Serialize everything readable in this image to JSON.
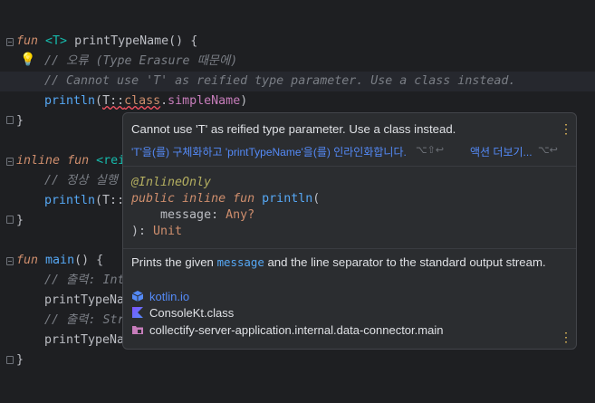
{
  "editor": {
    "lines": {
      "l1": {
        "kw": "fun",
        "tp": "<T>",
        "fn": "printTypeName",
        "rest": "() {"
      },
      "l2": {
        "comment": "// 오류 (Type Erasure 때문에)"
      },
      "l3": {
        "comment": "// Cannot use 'T' as reified type parameter. Use a class instead."
      },
      "l4": {
        "fn": "println",
        "open": "(",
        "err": "T::",
        "errkw": "class",
        "dot": ".",
        "prop": "simpleName",
        "close": ")"
      },
      "l5": {
        "text": "}"
      },
      "l6": {
        "kw1": "inline",
        "kw2": "fun",
        "rest": "<rei"
      },
      "l7": {
        "comment": "// 정상 실행"
      },
      "l8": {
        "fn": "println",
        "rest": "(T::"
      },
      "l9": {
        "text": "}"
      },
      "l10": {
        "kw": "fun",
        "fn": "main",
        "rest": "() {"
      },
      "l11": {
        "comment": "// 출력: Int"
      },
      "l12": {
        "fn": "printTypeNa"
      },
      "l13": {
        "comment": "// 출력: Str"
      },
      "l14": {
        "fn": "printTypeNa"
      },
      "l15": {
        "text": "}"
      }
    }
  },
  "popup": {
    "message": "Cannot use 'T' as reified type parameter. Use a class instead.",
    "quick_fix": "'T'을(를) 구체화하고 'printTypeName'을(를) 인라인화합니다.",
    "quick_fix_shortcut": "⌥⇧↩",
    "more_actions": "액션 더보기...",
    "more_actions_shortcut": "⌥↩",
    "signature": {
      "annotation": "@InlineOnly",
      "kw_public": "public",
      "kw_inline": "inline",
      "kw_fun": "fun",
      "name": "println",
      "paren_open": "(",
      "param_name": "message",
      "param_colon": ": ",
      "param_type": "Any?",
      "close": "): ",
      "return_type": "Unit"
    },
    "description_pre": "Prints the given ",
    "description_code": "message",
    "description_post": " and the line separator to the standard output stream.",
    "refs": {
      "module": "kotlin.io",
      "class": "ConsoleKt.class",
      "source": "collectify-server-application.internal.data-connector.main"
    }
  },
  "icons": [
    "lightbulb-icon",
    "more-vertical-icon",
    "fold-icon",
    "package-icon",
    "kotlin-icon",
    "module-icon"
  ],
  "colors": {
    "error_underline": "#f75464",
    "keyword": "#cf8e6d",
    "function": "#56a8f5",
    "link": "#548af7",
    "bulb": "#f2c55c"
  }
}
